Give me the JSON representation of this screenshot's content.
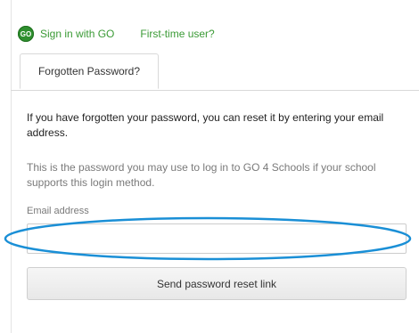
{
  "header": {
    "badge_text": "GO",
    "sign_in_label": "Sign in with GO",
    "first_time_label": "First-time user?"
  },
  "tabs": [
    {
      "label": "Forgotten Password?",
      "active": true
    }
  ],
  "form": {
    "intro_text": "If you have forgotten your password, you can reset it by entering your email address.",
    "note_text": "This is the password you may use to log in to GO 4 Schools if your school supports this login method.",
    "email_label": "Email address",
    "email_value": "",
    "email_placeholder": "",
    "submit_label": "Send password reset link"
  },
  "colors": {
    "link_green": "#3a9a35",
    "badge_green": "#2f8f2f",
    "highlight_blue": "#1a8fd6"
  }
}
